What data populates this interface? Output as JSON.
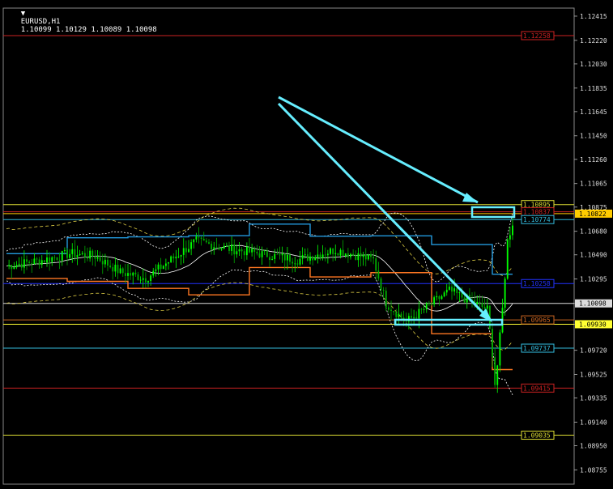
{
  "header": {
    "symbol": "EURUSD,H1",
    "ohlc": "1.10099 1.10129 1.10089 1.10098"
  },
  "chart_data": {
    "type": "candlestick",
    "ylim": [
      1.0864,
      1.1248
    ],
    "x_count": 200,
    "price_ticks": [
      "1.12415",
      "1.12220",
      "1.12030",
      "1.11835",
      "1.11645",
      "1.11450",
      "1.11260",
      "1.11065",
      "1.10875",
      "1.10680",
      "1.10490",
      "1.10295",
      "1.10098",
      "1.09930",
      "1.09720",
      "1.09525",
      "1.09335",
      "1.09140",
      "1.08950",
      "1.08755"
    ],
    "levels": [
      {
        "label": "1.12258",
        "value": 1.12258,
        "color": "#cc2222"
      },
      {
        "label": "1.10895",
        "value": 1.10895,
        "color": "#dddd33"
      },
      {
        "label": "1.10837",
        "value": 1.10837,
        "color": "#cc2222"
      },
      {
        "label": "1.10822",
        "value": 1.10822,
        "color": "#ffcc00",
        "hl": true
      },
      {
        "label": "1.10774",
        "value": 1.10774,
        "color": "#33bbdd"
      },
      {
        "label": "1.10258",
        "value": 1.10258,
        "color": "#2233ff"
      },
      {
        "label": "1.10098",
        "value": 1.10098,
        "color": "#dddddd",
        "hl": true
      },
      {
        "label": "1.09965",
        "value": 1.09965,
        "color": "#cc6622"
      },
      {
        "label": "1.09930",
        "value": 1.0993,
        "color": "#ffff33",
        "hl": true
      },
      {
        "label": "1.09737",
        "value": 1.09737,
        "color": "#33bbdd"
      },
      {
        "label": "1.09415",
        "value": 1.09415,
        "color": "#cc2222"
      },
      {
        "label": "1.09035",
        "value": 1.09035,
        "color": "#dddd33"
      }
    ],
    "close_keypoints": [
      [
        0,
        1.104
      ],
      [
        15,
        1.1045
      ],
      [
        25,
        1.105
      ],
      [
        35,
        1.1048
      ],
      [
        45,
        1.1035
      ],
      [
        55,
        1.103
      ],
      [
        65,
        1.1045
      ],
      [
        75,
        1.106
      ],
      [
        85,
        1.1055
      ],
      [
        100,
        1.105
      ],
      [
        115,
        1.1045
      ],
      [
        130,
        1.1053
      ],
      [
        145,
        1.1045
      ],
      [
        150,
        1.101
      ],
      [
        158,
        1.0995
      ],
      [
        165,
        1.1005
      ],
      [
        175,
        1.102
      ],
      [
        185,
        1.101
      ],
      [
        190,
        1.1005
      ],
      [
        192,
        1.097
      ],
      [
        193,
        1.0945
      ],
      [
        194,
        1.096
      ],
      [
        196,
        1.1005
      ],
      [
        198,
        1.106
      ],
      [
        200,
        1.1075
      ]
    ],
    "colors": {
      "bull": "#00ff00",
      "bear": "#00aa00",
      "arrow": "#66eeff",
      "bb": "#ffffff",
      "envelope": "#ddcc44",
      "upper_step": "#2299dd",
      "lower_step": "#ff7722"
    }
  }
}
